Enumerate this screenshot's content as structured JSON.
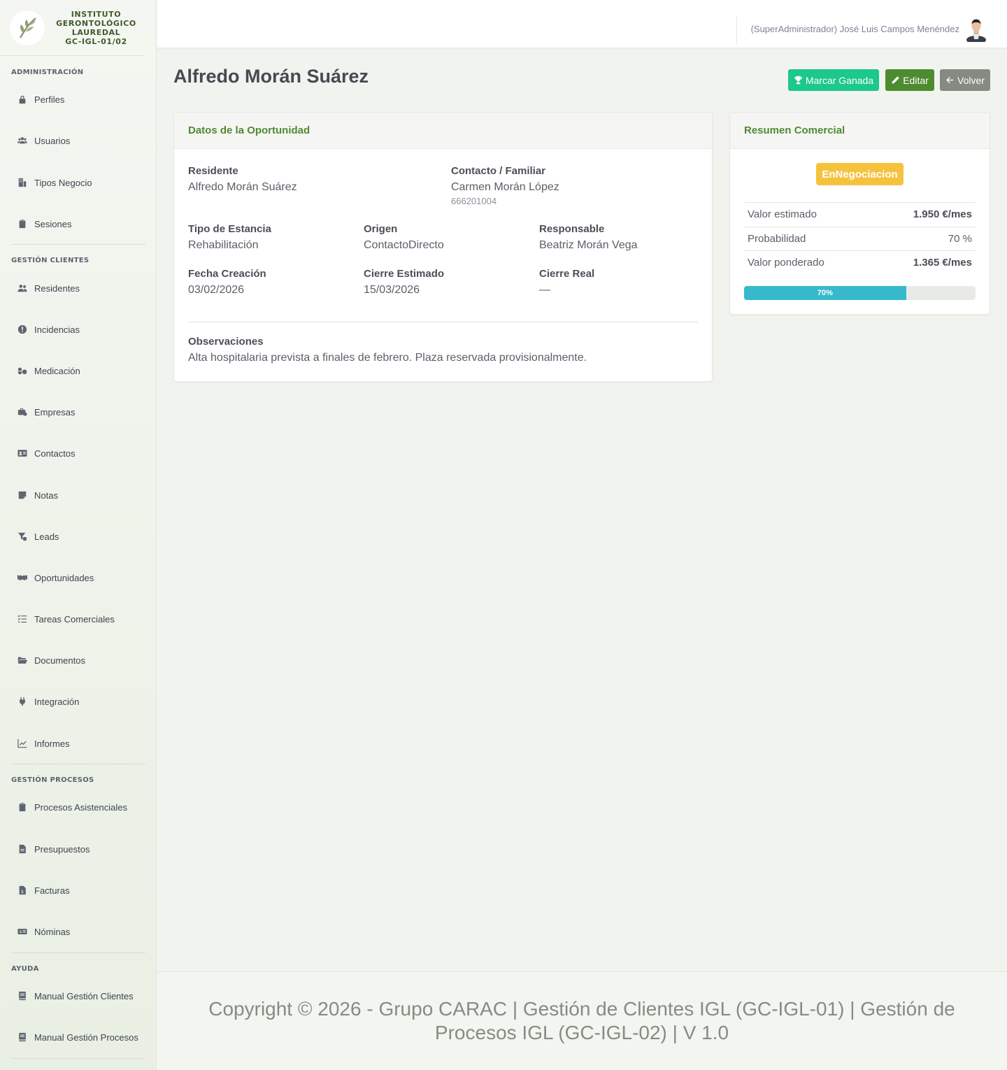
{
  "brand": {
    "line1": "INSTITUTO",
    "line2": "GERONTOLÓGICO",
    "line3": "LAUREDAL",
    "line4": "GC-IGL-01/02"
  },
  "sidebar": {
    "sections": [
      {
        "title": "ADMINISTRACIÓN",
        "items": [
          {
            "label": "Perfiles",
            "icon": "lock-icon"
          },
          {
            "label": "Usuarios",
            "icon": "users-icon"
          },
          {
            "label": "Tipos Negocio",
            "icon": "building-icon"
          },
          {
            "label": "Sesiones",
            "icon": "clipboard-icon"
          }
        ]
      },
      {
        "title": "GESTIÓN CLIENTES",
        "items": [
          {
            "label": "Residentes",
            "icon": "users-icon"
          },
          {
            "label": "Incidencias",
            "icon": "exclamation-icon"
          },
          {
            "label": "Medicación",
            "icon": "pills-icon"
          },
          {
            "label": "Empresas",
            "icon": "briefcase-icon"
          },
          {
            "label": "Contactos",
            "icon": "id-card-icon"
          },
          {
            "label": "Notas",
            "icon": "note-icon"
          },
          {
            "label": "Leads",
            "icon": "funnel-icon"
          },
          {
            "label": "Oportunidades",
            "icon": "handshake-icon"
          },
          {
            "label": "Tareas Comerciales",
            "icon": "checklist-icon"
          },
          {
            "label": "Documentos",
            "icon": "folder-icon"
          },
          {
            "label": "Integración",
            "icon": "plug-icon"
          },
          {
            "label": "Informes",
            "icon": "chart-line-icon"
          }
        ]
      },
      {
        "title": "GESTIÓN PROCESOS",
        "items": [
          {
            "label": "Procesos Asistenciales",
            "icon": "clipboard-icon"
          },
          {
            "label": "Presupuestos",
            "icon": "file-icon"
          },
          {
            "label": "Facturas",
            "icon": "invoice-icon"
          },
          {
            "label": "Nóminas",
            "icon": "money-icon"
          }
        ]
      },
      {
        "title": "AYUDA",
        "items": [
          {
            "label": "Manual Gestión Clientes",
            "icon": "book-icon"
          },
          {
            "label": "Manual Gestión Procesos",
            "icon": "book-icon"
          }
        ]
      }
    ]
  },
  "header": {
    "user": "(SuperAdministrador) José Luis Campos Menéndez"
  },
  "page": {
    "title": "Alfredo Morán Suárez",
    "actions": {
      "win": "Marcar Ganada",
      "edit": "Editar",
      "back": "Volver"
    }
  },
  "details": {
    "header": "Datos de la Oportunidad",
    "resident_label": "Residente",
    "resident_value": "Alfredo Morán Suárez",
    "contact_label": "Contacto / Familiar",
    "contact_value": "Carmen Morán López",
    "contact_phone": "666201004",
    "stay_label": "Tipo de Estancia",
    "stay_value": "Rehabilitación",
    "origin_label": "Origen",
    "origin_value": "ContactoDirecto",
    "owner_label": "Responsable",
    "owner_value": "Beatriz Morán Vega",
    "created_label": "Fecha Creación",
    "created_value": "03/02/2026",
    "est_close_label": "Cierre Estimado",
    "est_close_value": "15/03/2026",
    "real_close_label": "Cierre Real",
    "real_close_value": "—",
    "notes_label": "Observaciones",
    "notes_value": "Alta hospitalaria prevista a finales de febrero. Plaza reservada provisionalmente."
  },
  "summary": {
    "header": "Resumen Comercial",
    "status": "EnNegociacion",
    "status_color": "#f6c23e",
    "rows": [
      {
        "label": "Valor estimado",
        "value": "1.950 €/mes"
      },
      {
        "label": "Probabilidad",
        "value": "70 %"
      },
      {
        "label": "Valor ponderado",
        "value": "1.365 €/mes"
      }
    ],
    "progress_label": "70%",
    "progress_value": 0.7,
    "progress_color": "#36b9cc"
  },
  "footer": {
    "text": "Copyright © 2026 - Grupo CARAC | Gestión de Clientes IGL (GC-IGL-01) | Gestión de Procesos IGL (GC-IGL-02) | V 1.0"
  },
  "colors": {
    "accent_green": "#4e8a34",
    "success": "#1cc88a",
    "edit": "#4d8b2f",
    "back": "#858b80"
  }
}
